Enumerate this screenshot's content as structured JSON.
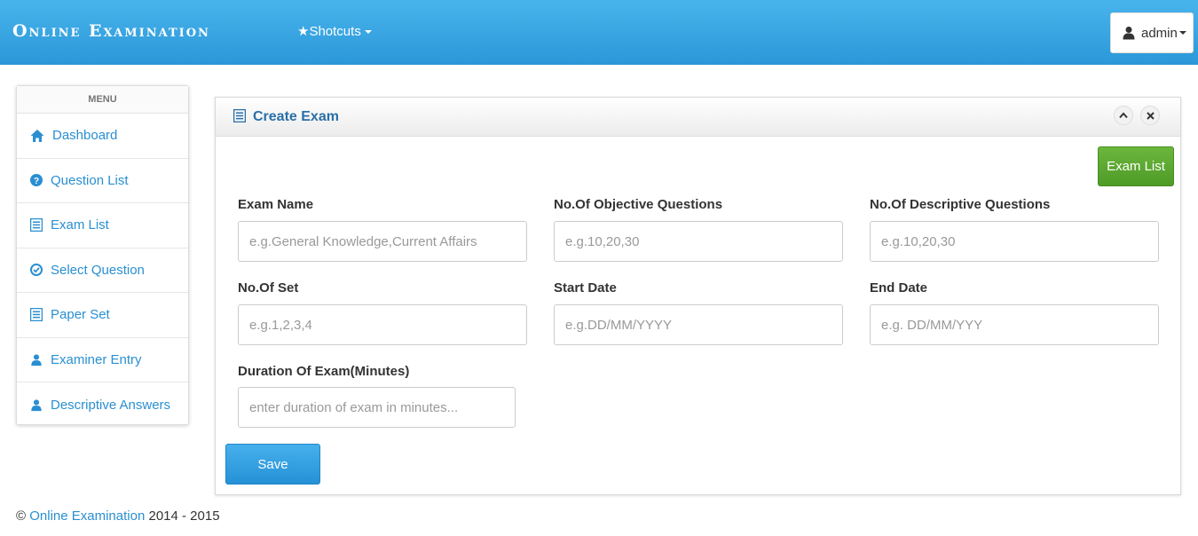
{
  "header": {
    "brand": "Online Examination",
    "shortcuts_label": "Shotcuts",
    "user_label": "admin"
  },
  "sidebar": {
    "title": "MENU",
    "items": [
      {
        "label": "Dashboard",
        "icon": "home-icon"
      },
      {
        "label": "Question List",
        "icon": "question-circle-icon"
      },
      {
        "label": "Exam List",
        "icon": "list-icon"
      },
      {
        "label": "Select Question",
        "icon": "check-circle-icon"
      },
      {
        "label": "Paper Set",
        "icon": "list-icon"
      },
      {
        "label": "Examiner Entry",
        "icon": "user-icon"
      },
      {
        "label": "Descriptive Answers",
        "icon": "user-icon"
      }
    ]
  },
  "panel": {
    "title": "Create Exam",
    "exam_list_button": "Exam List",
    "fields": {
      "exam_name": {
        "label": "Exam Name",
        "placeholder": "e.g.General Knowledge,Current Affairs"
      },
      "objective": {
        "label": "No.Of Objective Questions",
        "placeholder": "e.g.10,20,30"
      },
      "descriptive": {
        "label": "No.Of Descriptive Questions",
        "placeholder": "e.g.10,20,30"
      },
      "sets": {
        "label": "No.Of Set",
        "placeholder": "e.g.1,2,3,4"
      },
      "start_date": {
        "label": "Start Date",
        "placeholder": "e.g.DD/MM/YYYY"
      },
      "end_date": {
        "label": "End Date",
        "placeholder": "e.g. DD/MM/YYY"
      },
      "duration": {
        "label": "Duration Of Exam(Minutes)",
        "placeholder": "enter duration of exam in minutes..."
      }
    },
    "save_button": "Save"
  },
  "footer": {
    "copyright": "©",
    "link": "Online Examination",
    "years": "2014 - 2015"
  },
  "colors": {
    "header": "#2a97d8",
    "link": "#2a8fd1",
    "success": "#5aa832",
    "primary": "#2591d6"
  }
}
